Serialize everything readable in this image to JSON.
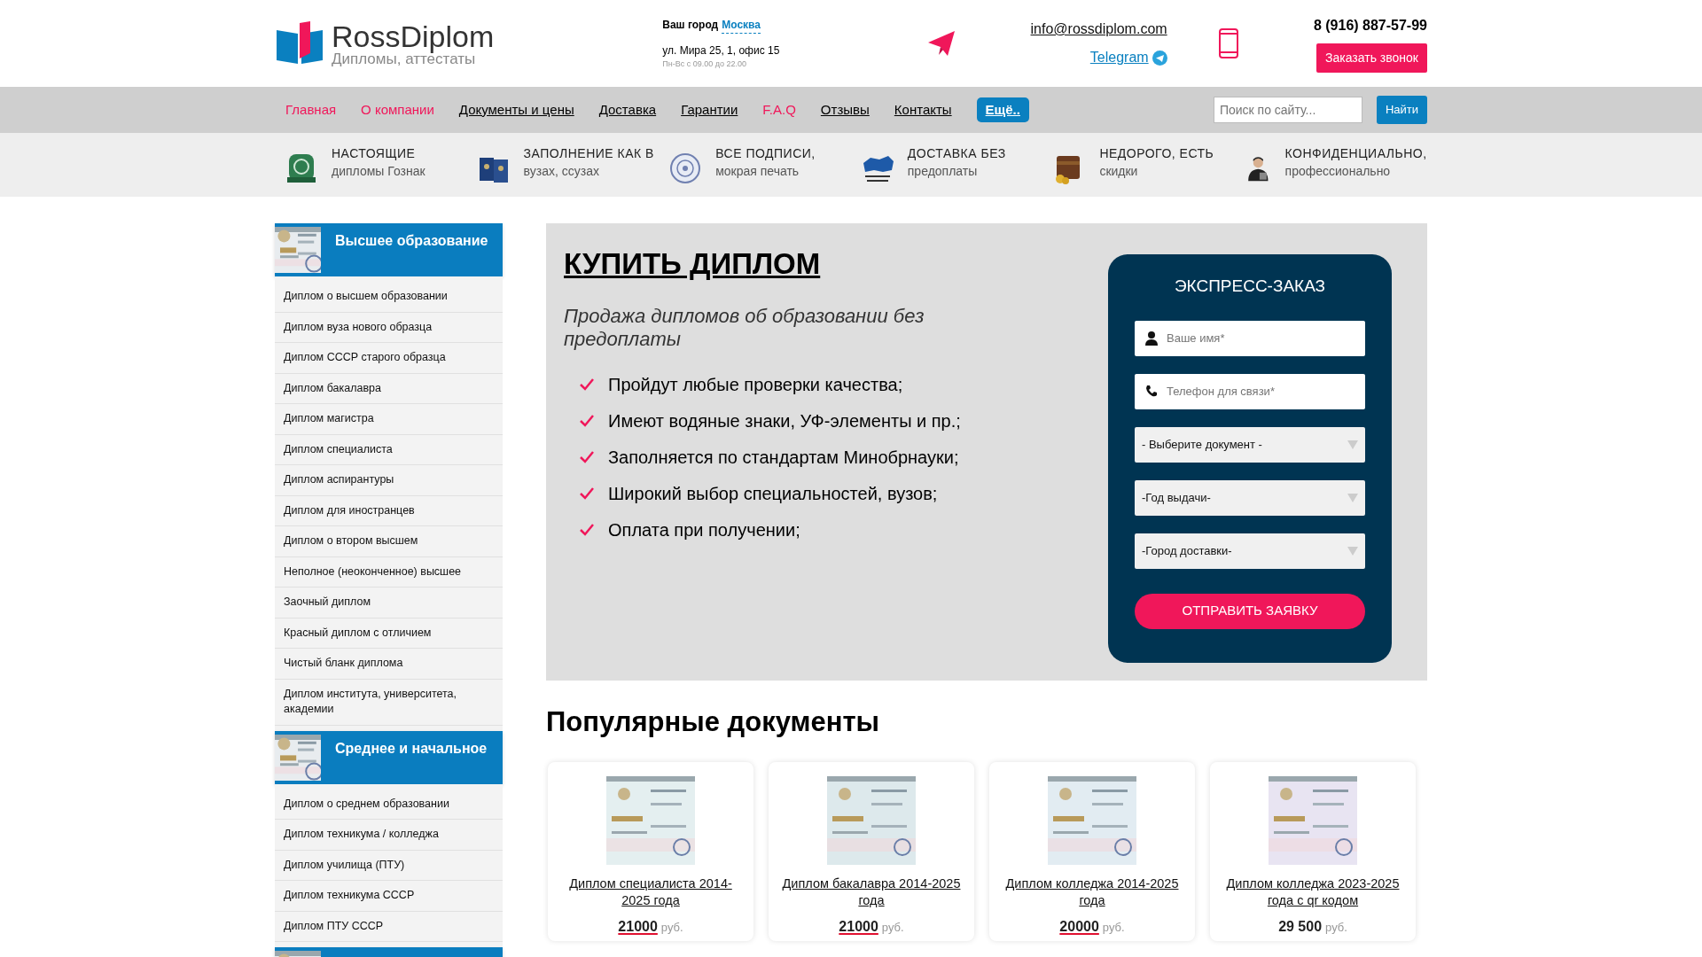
{
  "header": {
    "logo": {
      "name": "RossDiplom",
      "tagline": "Дипломы, аттестаты"
    },
    "city_label": "Ваш город",
    "city": "Москва",
    "address": "ул. Мира 25, 1, офис 15",
    "hours": "Пн-Вс с 09.00 до 22.00",
    "email": "info@rossdiplom.com",
    "telegram": "Telegram",
    "phone": "8 (916) 887-57-99",
    "callback_button": "Заказать звонок"
  },
  "nav": {
    "items": [
      {
        "label": "Главная",
        "highlighted": true
      },
      {
        "label": "О компании",
        "highlighted": true
      },
      {
        "label": "Документы и цены",
        "highlighted": false
      },
      {
        "label": "Доставка",
        "highlighted": false
      },
      {
        "label": "Гарантии",
        "highlighted": false
      },
      {
        "label": "F.A.Q",
        "highlighted": true
      },
      {
        "label": "Отзывы",
        "highlighted": false
      },
      {
        "label": "Контакты",
        "highlighted": false
      }
    ],
    "more_button": "Ещё..",
    "search": {
      "placeholder": "Поиск по сайту..."
    },
    "search_button": "Найти"
  },
  "features": [
    {
      "kind": "seal",
      "title": "НАСТОЯЩИЕ",
      "subtitle": "дипломы Гознак"
    },
    {
      "kind": "books",
      "title": "ЗАПОЛНЕНИЕ КАК В",
      "subtitle": "вузах, ссузах"
    },
    {
      "kind": "stamp",
      "title": "ВСЕ ПОДПИСИ,",
      "subtitle": "мокрая печать"
    },
    {
      "kind": "map",
      "title": "ДОСТАВКА БЕЗ",
      "subtitle": "предоплаты"
    },
    {
      "kind": "wallet",
      "title": "НЕДОРОГО, ЕСТЬ",
      "subtitle": "скидки"
    },
    {
      "kind": "person",
      "title": "КОНФИДЕНЦИАЛЬНО,",
      "subtitle": "профессионально"
    }
  ],
  "sidebar": {
    "sections": [
      {
        "kind": "full",
        "title": "Высшее образование",
        "items": [
          "Диплом о высшем образовании",
          "Диплом вуза нового образца",
          "Диплом СССР старого образца",
          "Диплом бакалавра",
          "Диплом магистра",
          "Диплом специалиста",
          "Диплом аспирантуры",
          "Диплом для иностранцев",
          "Диплом о втором высшем",
          "Неполное (неоконченное) высшее",
          "Заочный диплом",
          "Красный диплом с отличием",
          "Чистый бланк диплома",
          "Диплом института, университета, академии"
        ]
      },
      {
        "kind": "full",
        "title": "Среднее и начальное",
        "items": [
          "Диплом о среднем образовании",
          "Диплом техникума / колледжа",
          "Диплом училища (ПТУ)",
          "Диплом техникума СССР",
          "Диплом ПТУ СССР"
        ]
      },
      {
        "kind": "cut"
      }
    ]
  },
  "hero": {
    "title": "КУПИТЬ ДИПЛОМ",
    "subtitle": "Продажа дипломов об образовании без предоплаты",
    "checklist": [
      "Пройдут любые проверки качества;",
      "Имеют водяные знаки, УФ-элементы и пр.;",
      "Заполняется по стандартам Минобрнауки;",
      "Широкий выбор специальностей, вузов;",
      "Оплата при получении;"
    ]
  },
  "form": {
    "title": "ЭКСПРЕСС-ЗАКАЗ",
    "fields": [
      {
        "kind": "name",
        "placeholder": "Ваше имя*"
      },
      {
        "kind": "phone",
        "placeholder": "Телефон для связи*"
      },
      {
        "kind": "select",
        "value": "- Выберите документ -"
      },
      {
        "kind": "select",
        "value": "-Год выдачи-"
      },
      {
        "kind": "select",
        "value": "-Город доставки-"
      }
    ],
    "submit_button": "ОТПРАВИТЬ ЗАЯВКУ"
  },
  "popular": {
    "title": "Популярные документы",
    "cards": [
      {
        "title": "Диплом специалиста 2014-2025 года",
        "price": "21000",
        "currency": "руб.",
        "struck": true
      },
      {
        "title": "Диплом бакалавра 2014-2025 года",
        "price": "21000",
        "currency": "руб.",
        "struck": true
      },
      {
        "title": "Диплом колледжа 2014-2025 года",
        "price": "20000",
        "currency": "руб.",
        "struck": true
      },
      {
        "title": "Диплом колледжа 2023-2025 года с qr кодом",
        "price": "29 500",
        "currency": "руб.",
        "struck": false
      }
    ]
  }
}
